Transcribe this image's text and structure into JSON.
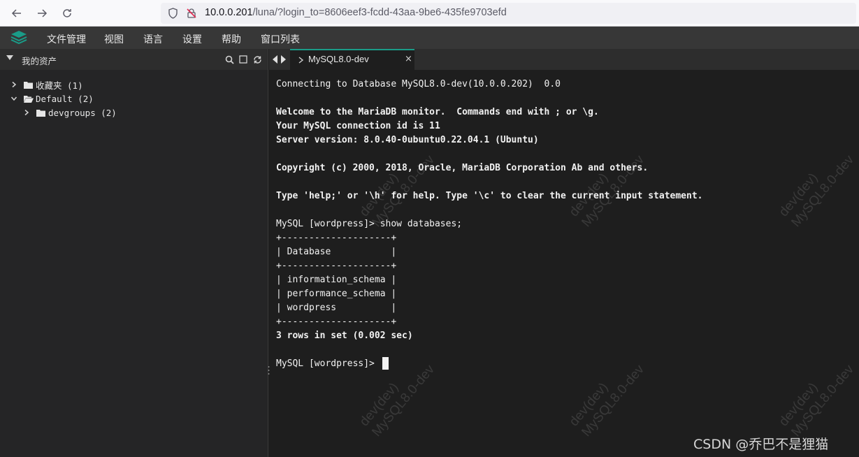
{
  "browser": {
    "url_host": "10.0.0.201",
    "url_path": "/luna/?login_to=8606eef3-fcdd-43aa-9be6-435fe9703efd"
  },
  "menu": {
    "items": [
      "文件管理",
      "视图",
      "语言",
      "设置",
      "帮助",
      "窗口列表"
    ]
  },
  "sidebar": {
    "title": "我的资产",
    "tree": [
      {
        "label": "收藏夹 (1)",
        "expanded": false
      },
      {
        "label": "Default (2)",
        "expanded": true
      },
      {
        "label": "devgroups (2)",
        "expanded": false
      }
    ]
  },
  "tabs": [
    {
      "label": "MySQL8.0-dev",
      "close": "×"
    }
  ],
  "terminal": {
    "lines": [
      "Connecting to Database MySQL8.0-dev(10.0.0.202)  0.0",
      "",
      "Welcome to the MariaDB monitor.  Commands end with ; or \\g.",
      "Your MySQL connection id is 11",
      "Server version: 8.0.40-0ubuntu0.22.04.1 (Ubuntu)",
      "",
      "Copyright (c) 2000, 2018, Oracle, MariaDB Corporation Ab and others.",
      "",
      "Type 'help;' or '\\h' for help. Type '\\c' to clear the current input statement.",
      "",
      "MySQL [wordpress]> show databases;",
      "+--------------------+",
      "| Database           |",
      "+--------------------+",
      "| information_schema |",
      "| performance_schema |",
      "| wordpress          |",
      "+--------------------+",
      "3 rows in set (0.002 sec)",
      "",
      "MySQL [wordpress]> "
    ]
  },
  "watermark": {
    "line1": "dev(dev)",
    "line2": "MySQL8.0-dev"
  },
  "credit": "CSDN @乔巴不是狸猫",
  "colors": {
    "accent": "#1a9c88",
    "terminal_bg": "#1e1e1e",
    "menu_bg": "#373737"
  }
}
